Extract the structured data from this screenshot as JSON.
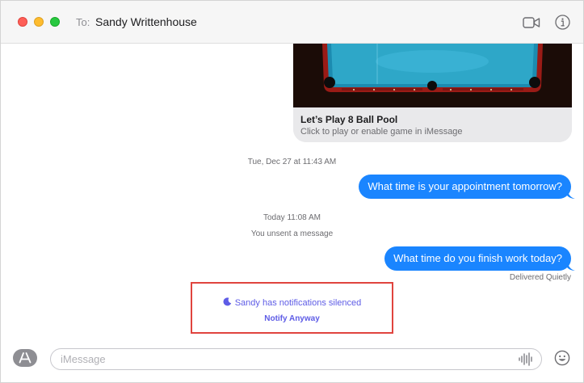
{
  "window": {
    "to_label": "To:",
    "recipient": "Sandy Writtenhouse"
  },
  "colors": {
    "imessage_blue": "#1a85ff",
    "silenced_purple": "#5e5ce6",
    "highlight_red": "#e0443e",
    "received_bubble": "#e9e9eb"
  },
  "icons": {
    "video": "video-camera-icon",
    "info": "info-icon",
    "moon": "moon-icon",
    "apps": "app-store-icon",
    "audio": "audio-waveform-icon",
    "emoji": "emoji-icon"
  },
  "conversation": {
    "game_card": {
      "title": "Let’s Play 8 Ball Pool",
      "subtitle": "Click to play or enable game in iMessage"
    },
    "timestamp_1": "Tue, Dec 27 at 11:43 AM",
    "message_1": "What time is your appointment tomorrow?",
    "timestamp_2": "Today 11:08 AM",
    "unsent_note": "You unsent a message",
    "message_2": "What time do you finish work today?",
    "delivery_status": "Delivered Quietly",
    "silenced_notice": "Sandy has notifications silenced",
    "notify_action": "Notify Anyway"
  },
  "composer": {
    "placeholder": "iMessage",
    "value": ""
  }
}
